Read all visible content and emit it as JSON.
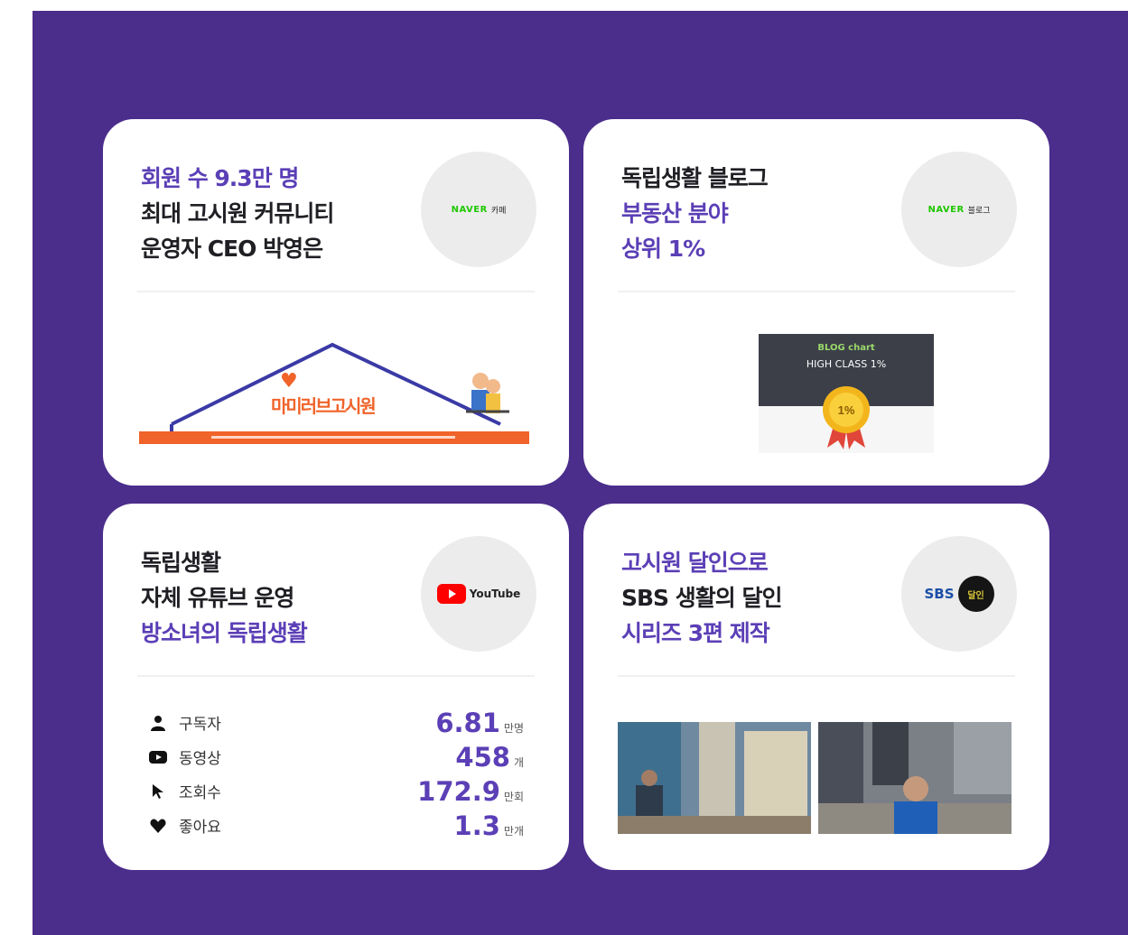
{
  "colors": {
    "background_panel": "#4b2d8c",
    "accent": "#5b3fb6",
    "card": "#ffffff",
    "orange": "#f0632a"
  },
  "cards": [
    {
      "lines": [
        {
          "text": "회원 수 9.3만 명",
          "accent": true
        },
        {
          "text": "최대 고시원 커뮤니티",
          "accent": false
        },
        {
          "text": "운영자 CEO 박영은",
          "accent": false
        }
      ],
      "badge": {
        "brand": "NAVER",
        "label": "카페",
        "icon": "naver-cafe-icon"
      },
      "illustration": {
        "title": "마미러브고시원",
        "icon": "house-roof-illustration"
      }
    },
    {
      "lines": [
        {
          "text": "독립생활 블로그",
          "accent": false
        },
        {
          "text": "부동산 분야",
          "accent": true
        },
        {
          "text": "상위 1%",
          "accent": true
        }
      ],
      "badge": {
        "brand": "NAVER",
        "label": "블로그",
        "icon": "naver-blog-icon"
      },
      "award": {
        "brand": "BLOG chart",
        "title": "HIGH CLASS 1%",
        "medal": "1%",
        "icon": "gold-medal-icon"
      }
    },
    {
      "lines": [
        {
          "text": "독립생활",
          "accent": false
        },
        {
          "text": "자체 유튜브 운영",
          "accent": false
        },
        {
          "text": "방소녀의 독립생활",
          "accent": true
        }
      ],
      "badge": {
        "brand": "YouTube",
        "icon": "youtube-icon"
      },
      "stats": [
        {
          "icon": "person-icon",
          "label": "구독자",
          "value": "6.81",
          "unit": "만명"
        },
        {
          "icon": "video-icon",
          "label": "동영상",
          "value": "458",
          "unit": "개"
        },
        {
          "icon": "cursor-icon",
          "label": "조회수",
          "value": "172.9",
          "unit": "만회"
        },
        {
          "icon": "heart-icon",
          "label": "좋아요",
          "value": "1.3",
          "unit": "만개"
        }
      ]
    },
    {
      "lines": [
        {
          "text": "고시원 달인으로",
          "accent": true
        },
        {
          "text": "SBS 생활의 달인",
          "accent": false
        },
        {
          "text": "시리즈 3편 제작",
          "accent": true
        }
      ],
      "badge": {
        "brand": "SBS",
        "logo_text": "달인",
        "icon": "sbs-logo-icon"
      },
      "thumbnails": [
        {
          "icon": "tv-scene-thumbnail-1"
        },
        {
          "icon": "tv-scene-thumbnail-2"
        }
      ]
    }
  ]
}
